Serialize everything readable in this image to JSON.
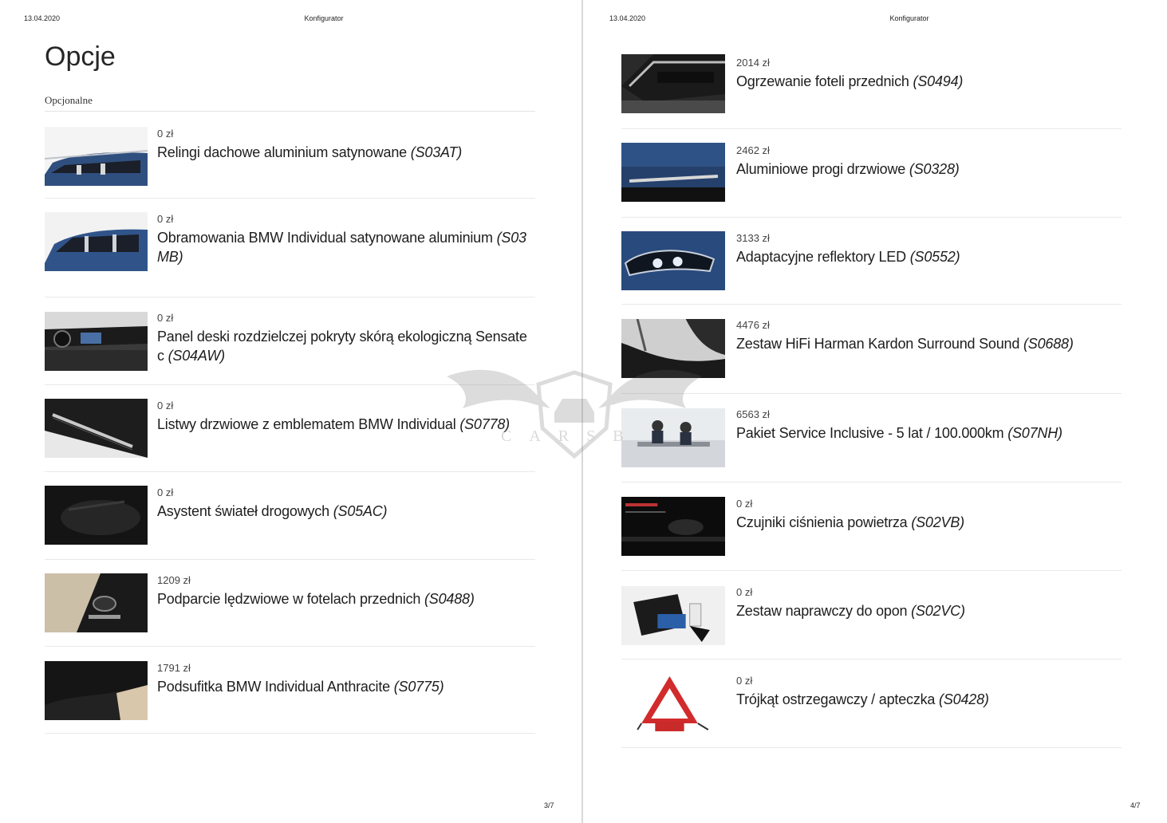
{
  "left_page": {
    "date": "13.04.2020",
    "header_title": "Konfigurator",
    "title": "Opcje",
    "subheading": "Opcjonalne",
    "page_number": "3/7",
    "options": [
      {
        "price": "0 zł",
        "name": "Relingi dachowe aluminium satynowane",
        "code": "(S03AT)",
        "thumb": "car-roof-blue"
      },
      {
        "price": "0 zł",
        "name": "Obramowania BMW Individual satynowane aluminium",
        "code": "(S03 MB)",
        "thumb": "car-side-blue"
      },
      {
        "price": "0 zł",
        "name": "Panel deski rozdzielczej pokryty skórą ekologiczną Sensate c",
        "code": "(S04AW)",
        "thumb": "dashboard"
      },
      {
        "price": "0 zł",
        "name": "Listwy drzwiowe z emblematem BMW Individual",
        "code": "(S0778)",
        "thumb": "door-sill"
      },
      {
        "price": "0 zł",
        "name": "Asystent świateł drogowych",
        "code": "(S05AC)",
        "thumb": "dark-interior"
      },
      {
        "price": "1209 zł",
        "name": "Podparcie lędzwiowe w fotelach przednich",
        "code": "(S0488)",
        "thumb": "seat-controls"
      },
      {
        "price": "1791 zł",
        "name": "Podsufitka BMW Individual Anthracite",
        "code": "(S0775)",
        "thumb": "headliner"
      }
    ]
  },
  "right_page": {
    "date": "13.04.2020",
    "header_title": "Konfigurator",
    "page_number": "4/7",
    "options": [
      {
        "price": "2014 zł",
        "name": "Ogrzewanie foteli przednich",
        "code": "(S0494)",
        "thumb": "air-vent"
      },
      {
        "price": "2462 zł",
        "name": "Aluminiowe progi drzwiowe",
        "code": "(S0328)",
        "thumb": "side-step-blue"
      },
      {
        "price": "3133 zł",
        "name": "Adaptacyjne reflektory LED",
        "code": "(S0552)",
        "thumb": "headlight-blue"
      },
      {
        "price": "4476 zł",
        "name": "Zestaw HiFi Harman Kardon Surround Sound",
        "code": "(S0688)",
        "thumb": "speaker"
      },
      {
        "price": "6563 zł",
        "name": "Pakiet Service Inclusive - 5 lat / 100.000km",
        "code": "(S07NH)",
        "thumb": "service-desk"
      },
      {
        "price": "0 zł",
        "name": "Czujniki ciśnienia powietrza",
        "code": "(S02VB)",
        "thumb": "tpms-screen"
      },
      {
        "price": "0 zł",
        "name": "Zestaw naprawczy do opon",
        "code": "(S02VC)",
        "thumb": "repair-kit"
      },
      {
        "price": "0 zł",
        "name": "Trójkąt ostrzegawczy / apteczka",
        "code": "(S0428)",
        "thumb": "warning-triangle"
      }
    ]
  },
  "watermark": {
    "text": "CARSB",
    "logo": "bat-wings-shield-car-logo"
  },
  "colors": {
    "car_blue": "#2f4f7f",
    "divider": "#d9d9d9",
    "warning_red": "#d22b2b"
  }
}
